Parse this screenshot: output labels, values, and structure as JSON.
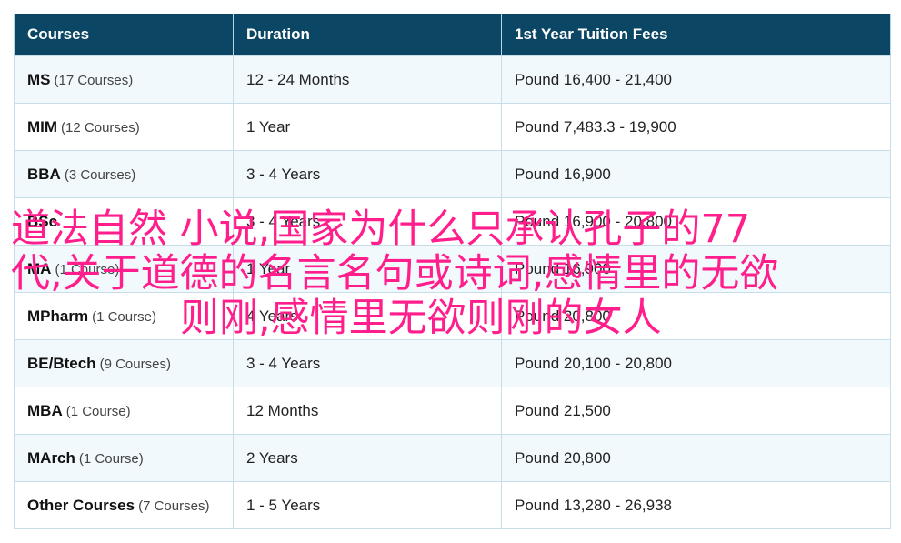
{
  "table": {
    "headers": [
      "Courses",
      "Duration",
      "1st Year Tuition Fees"
    ],
    "rows": [
      {
        "course": "MS",
        "count": "(17 Courses)",
        "duration": "12 - 24 Months",
        "fees": "Pound 16,400 - 21,400"
      },
      {
        "course": "MIM",
        "count": "(12 Courses)",
        "duration": "1 Year",
        "fees": "Pound 7,483.3 - 19,900"
      },
      {
        "course": "BBA",
        "count": "(3 Courses)",
        "duration": "3 - 4 Years",
        "fees": "Pound 16,900"
      },
      {
        "course": "BSc",
        "count": "",
        "duration": "3 - 4 Years",
        "fees": "Pound 16,900 - 20,800"
      },
      {
        "course": "MA",
        "count": "(1 Course)",
        "duration": "1 Year",
        "fees": "Pound 16,900"
      },
      {
        "course": "MPharm",
        "count": "(1 Course)",
        "duration": "4 Years",
        "fees": "Pound 20,800"
      },
      {
        "course": "BE/Btech",
        "count": "(9 Courses)",
        "duration": "3 - 4 Years",
        "fees": "Pound 20,100 - 20,800"
      },
      {
        "course": "MBA",
        "count": "(1 Course)",
        "duration": "12 Months",
        "fees": "Pound 21,500"
      },
      {
        "course": "MArch",
        "count": "(1 Course)",
        "duration": "2 Years",
        "fees": "Pound 20,800"
      },
      {
        "course": "Other Courses",
        "count": "(7 Courses)",
        "duration": "1 - 5 Years",
        "fees": "Pound 13,280 - 26,938"
      }
    ]
  },
  "overlay": {
    "lines": [
      "道法自然 小说,国家为什么只承认孔子的77",
      "代,关于道德的名言名句或诗词,感情里的无欲",
      "则刚,感情里无欲则刚的女人"
    ],
    "color": "#ff1e8c"
  },
  "colors": {
    "header_bg": "#0b4664",
    "row_alt_bg": "#f2f9fd",
    "border": "#c7dde8"
  }
}
